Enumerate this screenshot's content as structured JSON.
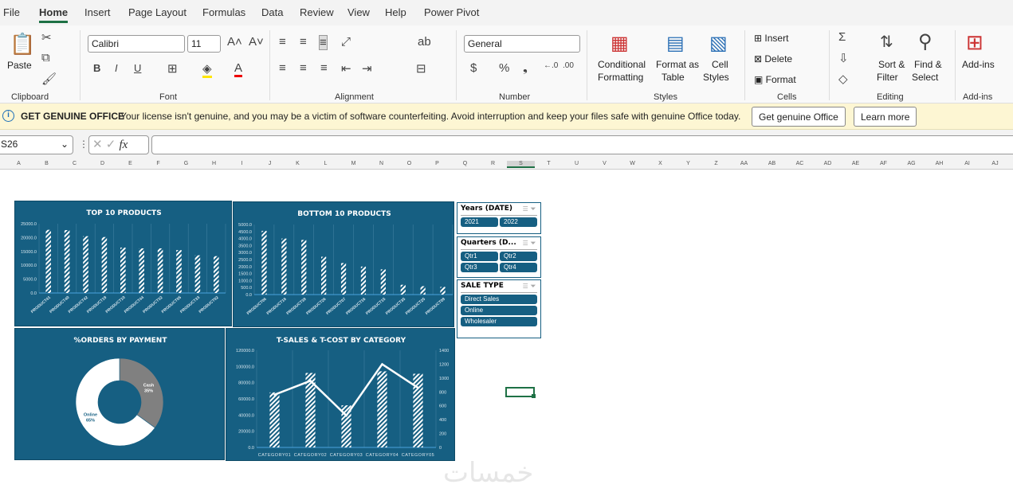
{
  "tabs": [
    "File",
    "Home",
    "Insert",
    "Page Layout",
    "Formulas",
    "Data",
    "Review",
    "View",
    "Help",
    "Power Pivot"
  ],
  "active_tab": "Home",
  "ribbon": {
    "paste": "Paste",
    "font_name": "Calibri",
    "font_size": "11",
    "number_format": "General",
    "conditional": "Conditional",
    "formatting": "Formatting",
    "format_as": "Format as",
    "table": "Table",
    "cell": "Cell",
    "styles_lbl": "Styles",
    "insert": "Insert",
    "delete": "Delete",
    "format": "Format",
    "sort": "Sort &",
    "filter": "Filter",
    "find": "Find &",
    "select": "Select",
    "addins": "Add-ins",
    "groups": [
      "Clipboard",
      "Font",
      "Alignment",
      "Number",
      "Styles",
      "Cells",
      "Editing",
      "Add-ins"
    ]
  },
  "infobar": {
    "title": "GET GENUINE OFFICE",
    "message": "Your license isn't genuine, and you may be a victim of software counterfeiting. Avoid interruption and keep your files safe with genuine Office today.",
    "btn1": "Get genuine Office",
    "btn2": "Learn more"
  },
  "formula_bar": {
    "name_box": "S26",
    "fx": "fx",
    "value": ""
  },
  "columns": [
    "A",
    "B",
    "C",
    "D",
    "E",
    "F",
    "G",
    "H",
    "I",
    "J",
    "K",
    "L",
    "M",
    "N",
    "O",
    "P",
    "Q",
    "R",
    "S",
    "T",
    "U",
    "V",
    "W",
    "X",
    "Y",
    "Z",
    "AA",
    "AB",
    "AC",
    "AD",
    "AE",
    "AF",
    "AG",
    "AH",
    "AI",
    "AJ"
  ],
  "slicers": [
    {
      "title": "Years (DATE)",
      "items": [
        "2021",
        "2022"
      ]
    },
    {
      "title": "Quarters (D...",
      "items": [
        "Qtr1",
        "Qtr2",
        "Qtr3",
        "Qtr4"
      ]
    },
    {
      "title": "SALE TYPE",
      "items": [
        "Direct Sales",
        "Online",
        "Wholesaler"
      ]
    }
  ],
  "watermark": "خمسات",
  "colors": {
    "chart_bg": "#165f82",
    "accent": "#1e7145",
    "donut_cash": "#808080",
    "donut_online": "#ffffff"
  },
  "chart_data": [
    {
      "type": "bar",
      "title": "TOP 10 PRODUCTS",
      "categories": [
        "PRODUCT41",
        "PRODUCT40",
        "PRODUCT42",
        "PRODUCT19",
        "PRODUCT10",
        "PRODUCT44",
        "PRODUCT32",
        "PRODUCT05",
        "PRODUCT33",
        "PRODUCT02"
      ],
      "values": [
        22800,
        22700,
        20500,
        20200,
        16400,
        16100,
        16100,
        15500,
        13600,
        13300
      ],
      "ylim": [
        0,
        25000
      ],
      "yticks": [
        "0.0",
        "5000.0",
        "10000.0",
        "15000.0",
        "20000.0",
        "25000.0"
      ],
      "grid": true
    },
    {
      "type": "bar",
      "title": "BOTTOM 10 PRODUCTS",
      "categories": [
        "PRODUCT06",
        "PRODUCT18",
        "PRODUCT39",
        "PRODUCT26",
        "PRODUCT07",
        "PRODUCT16",
        "PRODUCT15",
        "PRODUCT35",
        "PRODUCT25",
        "PRODUCT09"
      ],
      "values": [
        4550,
        4000,
        3900,
        2700,
        2250,
        2000,
        1800,
        700,
        600,
        550
      ],
      "ylim": [
        0,
        5000
      ],
      "yticks": [
        "0.0",
        "500.0",
        "1000.0",
        "1500.0",
        "2000.0",
        "2500.0",
        "3000.0",
        "3500.0",
        "4000.0",
        "4500.0",
        "5000.0"
      ],
      "grid": true
    },
    {
      "type": "pie",
      "title": "%ORDERS BY PAYMENT",
      "donut": true,
      "slices": [
        {
          "label": "Cash",
          "value": 35,
          "text": "35%"
        },
        {
          "label": "Online",
          "value": 65,
          "text": "65%"
        }
      ]
    },
    {
      "type": "bar",
      "title": "T-SALES & T-COST BY CATEGORY",
      "categories": [
        "CATEGORY01",
        "CATEGORY02",
        "CATEGORY03",
        "CATEGORY04",
        "CATEGORY05"
      ],
      "series": [
        {
          "values": [
            68000,
            92000,
            52000,
            94000,
            91000
          ],
          "axis": "left"
        },
        {
          "type": "line",
          "values": [
            760,
            960,
            460,
            1200,
            860
          ],
          "axis": "right"
        }
      ],
      "ylim": [
        0,
        120000
      ],
      "y2lim": [
        0,
        1400
      ],
      "yticks": [
        "0.0",
        "20000.0",
        "40000.0",
        "60000.0",
        "80000.0",
        "100000.0",
        "120000.0"
      ],
      "y2ticks": [
        "0",
        "200",
        "400",
        "600",
        "800",
        "1000",
        "1200",
        "1400"
      ],
      "grid": true
    }
  ]
}
